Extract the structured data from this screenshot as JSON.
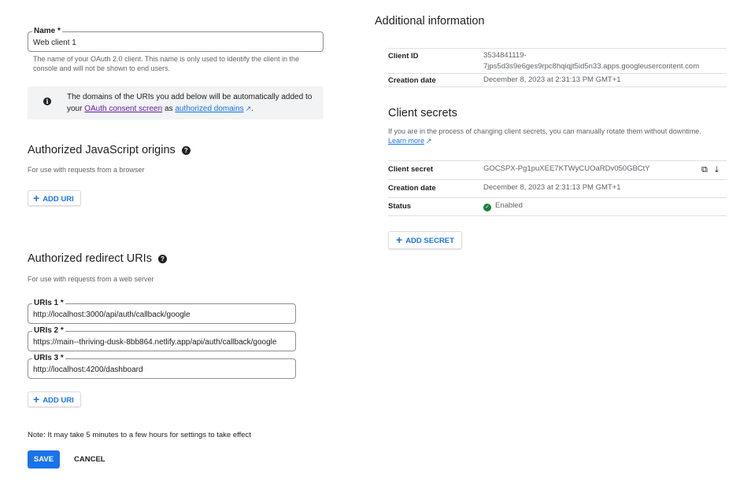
{
  "left": {
    "name_field": {
      "label": "Name *",
      "value": "Web client 1",
      "help": "The name of your OAuth 2.0 client. This name is only used to identify the client in the console and will not be shown to end users."
    },
    "info_box": {
      "text_before": "The domains of the URIs you add below will be automatically added to your ",
      "consent_link": "OAuth consent screen",
      "text_mid": " as ",
      "domains_link": "authorized domains",
      "text_after": "."
    },
    "js_origins": {
      "title": "Authorized JavaScript origins",
      "subtitle": "For use with requests from a browser",
      "add_button": "ADD URI"
    },
    "redirect_uris": {
      "title": "Authorized redirect URIs",
      "subtitle": "For use with requests from a web server",
      "uris": [
        {
          "label": "URIs 1 *",
          "value": "http://localhost:3000/api/auth/callback/google"
        },
        {
          "label": "URIs 2 *",
          "value": "https://main--thriving-dusk-8bb864.netlify.app/api/auth/callback/google"
        },
        {
          "label": "URIs 3 *",
          "value": "http://localhost:4200/dashboard"
        }
      ],
      "add_button": "ADD URI"
    },
    "note": "Note: It may take 5 minutes to a few hours for settings to take effect",
    "save_label": "SAVE",
    "cancel_label": "CANCEL"
  },
  "right": {
    "title": "Additional information",
    "client_id_label": "Client ID",
    "client_id_line1": "3534841119-",
    "client_id_line2": "7jps5d3s9e6ges9rpc8hqiqjt5id5n33.apps.googleusercontent.com",
    "creation_date_label": "Creation date",
    "creation_date": "December 8, 2023 at 2:31:13 PM GMT+1",
    "client_secrets": {
      "title": "Client secrets",
      "description": "If you are in the process of changing client secrets, you can manually rotate them without downtime. ",
      "learn_more": "Learn more",
      "secret_label": "Client secret",
      "secret_value": "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",
      "creation_date_label": "Creation date",
      "creation_date": "December 8, 2023 at 2:31:13 PM GMT+1",
      "status_label": "Status",
      "status_value": "Enabled",
      "add_secret": "ADD SECRET"
    }
  },
  "icons": {
    "info": "info-icon",
    "help": "help-circle-icon",
    "external": "external-link-icon",
    "plus": "plus-icon",
    "copy": "copy-icon",
    "download": "download-icon",
    "check": "check-circle-icon"
  },
  "colors": {
    "primary": "#1a73e8",
    "visited_link": "#681da8",
    "success": "#188038"
  }
}
